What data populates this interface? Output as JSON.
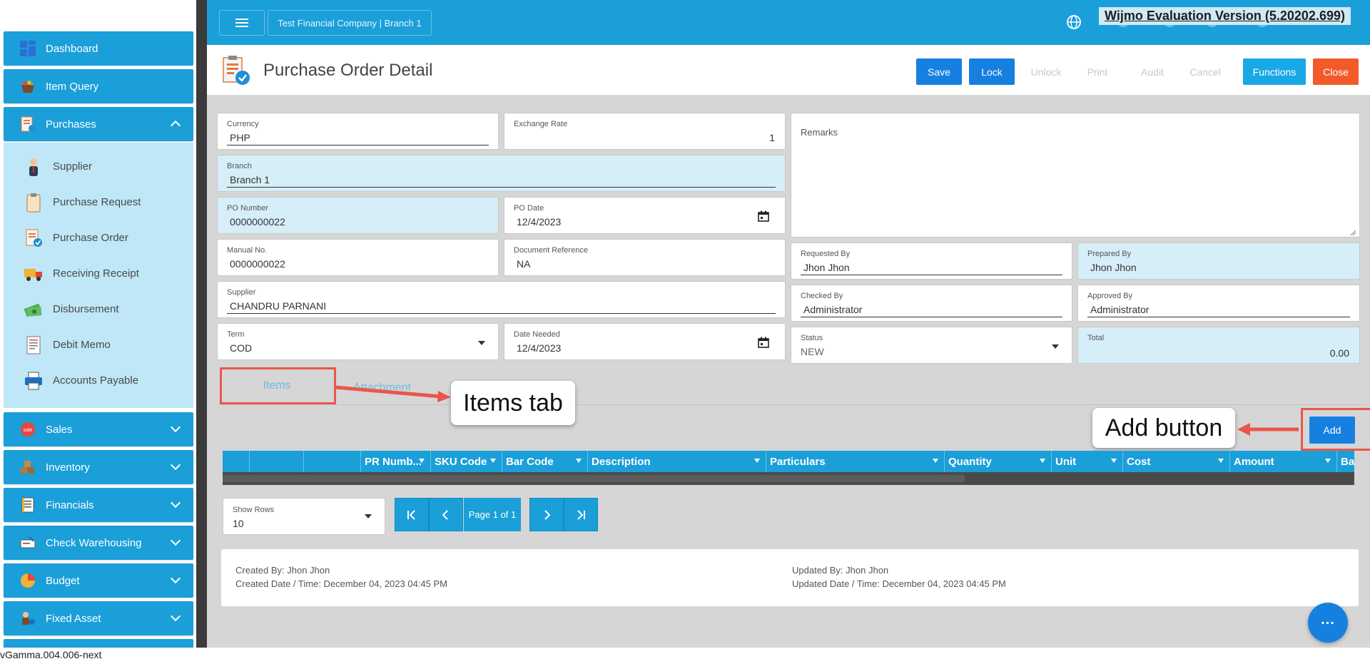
{
  "sidebar": {
    "items": [
      {
        "label": "Dashboard",
        "icon": "dashboard-icon"
      },
      {
        "label": "Item Query",
        "icon": "basket-icon"
      },
      {
        "label": "Purchases",
        "icon": "purchases-icon",
        "expanded": true
      },
      {
        "label": "Sales",
        "icon": "sale-tag-icon"
      },
      {
        "label": "Inventory",
        "icon": "boxes-icon"
      },
      {
        "label": "Financials",
        "icon": "ledger-icon"
      },
      {
        "label": "Check Warehousing",
        "icon": "check-icon"
      },
      {
        "label": "Budget",
        "icon": "pie-chart-icon"
      },
      {
        "label": "Fixed Asset",
        "icon": "asset-gear-icon"
      }
    ],
    "purchases_sub": [
      {
        "label": "Supplier",
        "icon": "person-icon"
      },
      {
        "label": "Purchase Request",
        "icon": "clipboard-icon"
      },
      {
        "label": "Purchase Order",
        "icon": "order-check-icon"
      },
      {
        "label": "Receiving Receipt",
        "icon": "truck-icon"
      },
      {
        "label": "Disbursement",
        "icon": "money-icon"
      },
      {
        "label": "Debit Memo",
        "icon": "memo-icon"
      },
      {
        "label": "Accounts Payable",
        "icon": "printer-icon"
      }
    ]
  },
  "topbar": {
    "company": "Test Financial Company | Branch 1",
    "watermark": "Wijmo Evaluation Version (5.20202.699)"
  },
  "header": {
    "title": "Purchase Order Detail",
    "buttons": {
      "save": "Save",
      "lock": "Lock",
      "unlock": "Unlock",
      "print": "Print",
      "audit": "Audit",
      "cancel": "Cancel",
      "functions": "Functions",
      "close": "Close"
    }
  },
  "form": {
    "currency": {
      "label": "Currency",
      "value": "PHP"
    },
    "exchange_rate": {
      "label": "Exchange Rate",
      "value": "1"
    },
    "remarks": {
      "label": "Remarks",
      "value": ""
    },
    "branch": {
      "label": "Branch",
      "value": "Branch 1"
    },
    "po_number": {
      "label": "PO Number",
      "value": "0000000022"
    },
    "po_date": {
      "label": "PO Date",
      "value": "12/4/2023"
    },
    "manual_no": {
      "label": "Manual No.",
      "value": "0000000022"
    },
    "document_reference": {
      "label": "Document Reference",
      "value": "NA"
    },
    "requested_by": {
      "label": "Requested By",
      "value": "Jhon Jhon"
    },
    "prepared_by": {
      "label": "Prepared By",
      "value": "Jhon Jhon"
    },
    "supplier": {
      "label": "Supplier",
      "value": "CHANDRU PARNANI"
    },
    "checked_by": {
      "label": "Checked By",
      "value": "Administrator"
    },
    "approved_by": {
      "label": "Approved By",
      "value": "Administrator"
    },
    "term": {
      "label": "Term",
      "value": "COD"
    },
    "date_needed": {
      "label": "Date Needed",
      "value": "12/4/2023"
    },
    "status": {
      "label": "Status",
      "value": "NEW"
    },
    "total": {
      "label": "Total",
      "value": "0.00"
    }
  },
  "tabs": {
    "items": "Items",
    "attachment": "Attachment"
  },
  "annotations": {
    "items_tab": "Items tab",
    "add_button": "Add button"
  },
  "grid": {
    "add_label": "Add",
    "columns": [
      "PR Numb...",
      "SKU Code",
      "Bar Code",
      "Description",
      "Particulars",
      "Quantity",
      "Unit",
      "Cost",
      "Amount",
      "Bas"
    ]
  },
  "pager": {
    "show_rows_label": "Show Rows",
    "show_rows_value": "10",
    "page_text": "Page 1 of 1"
  },
  "audit": {
    "created_by": "Created By: Jhon Jhon",
    "created_date": "Created Date / Time: December 04, 2023 04:45 PM",
    "updated_by": "Updated By: Jhon Jhon",
    "updated_date": "Updated Date / Time: December 04, 2023 04:45 PM"
  },
  "fab": {
    "label": "..."
  },
  "version": "vGamma.004.006-next",
  "colors": {
    "primary": "#1a9fd9",
    "button_blue": "#1580e0",
    "close_red": "#f25a2a",
    "annotation_red": "#e8574a"
  }
}
